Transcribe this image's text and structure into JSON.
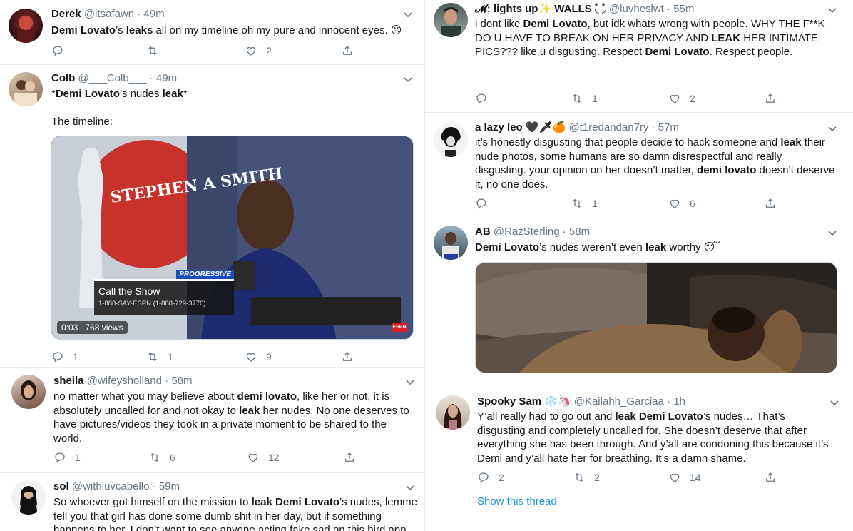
{
  "left": [
    {
      "name": "Derek",
      "handle": "@itsafawn",
      "time": "49m",
      "text": [
        [
          "n",
          "Demi Lovato"
        ],
        [
          "t",
          "’s "
        ],
        [
          "b",
          "leaks"
        ],
        [
          "t",
          " all on my timeline oh my pure and innocent eyes. 😣"
        ]
      ],
      "reply": "",
      "retweet": "",
      "like": "2"
    },
    {
      "name": "Colb",
      "handle": "@___Colb___",
      "time": "49m",
      "text": [
        [
          "t",
          "*"
        ],
        [
          "b",
          "Demi Lovato"
        ],
        [
          "t",
          "’s nudes "
        ],
        [
          "b",
          "leak"
        ],
        [
          "t",
          "*"
        ]
      ],
      "text2": "The timeline:",
      "video": {
        "time": "0:03",
        "views": "768 views",
        "lower_title": "Call the Show",
        "lower_sub": "1-888-SAY-ESPN (1-888-729-3776)",
        "brand": "STEPHEN A SMITH",
        "tag": "PROGRESSIVE"
      },
      "reply": "1",
      "retweet": "1",
      "like": "9"
    },
    {
      "name": "sheila",
      "handle": "@wifeysholland",
      "time": "58m",
      "text": [
        [
          "t",
          "no matter what you may believe about "
        ],
        [
          "b",
          "demi lovato"
        ],
        [
          "t",
          ", like her or not, it is absolutely uncalled for and not okay to "
        ],
        [
          "b",
          "leak"
        ],
        [
          "t",
          " her nudes. No one deserves to have pictures/videos they took in a private moment to be shared to the world."
        ]
      ],
      "reply": "1",
      "retweet": "6",
      "like": "12"
    },
    {
      "name": "sol",
      "handle": "@withluvcabello",
      "time": "59m",
      "text": [
        [
          "t",
          "So whoever got himself on the mission to "
        ],
        [
          "b",
          "leak Demi Lovato"
        ],
        [
          "t",
          "’s nudes, lemme tell you that girl has done some dumb shit in her day, but if something happens to her, I don’t want to see anyone acting fake sad on this bird app."
        ]
      ]
    }
  ],
  "right": [
    {
      "name": "𝓜; lights up✨ WALLS ◟̽ ◞̽",
      "handle": "@luvheslwt",
      "time": "55m",
      "text": [
        [
          "t",
          "i dont like "
        ],
        [
          "b",
          "Demi Lovato"
        ],
        [
          "t",
          ", but idk whats wrong with people. WHY THE F**K DO U HAVE TO BREAK ON HER PRIVACY AND "
        ],
        [
          "b",
          "LEAK"
        ],
        [
          "t",
          " HER INTIMATE PICS??? like u disgusting. Respect "
        ],
        [
          "b",
          "Demi Lovato"
        ],
        [
          "t",
          ". Respect people."
        ]
      ],
      "reply": "",
      "retweet": "1",
      "like": "2"
    },
    {
      "name": "a lazy leo 🖤🗡🍊",
      "handle": "@t1redandan7ry",
      "time": "57m",
      "text": [
        [
          "t",
          "it’s honestly disgusting that people decide to hack someone and "
        ],
        [
          "b",
          "leak"
        ],
        [
          "t",
          " their nude photos, some humans are so damn disrespectful and really disgusting. your opinion on her doesn’t matter, "
        ],
        [
          "b",
          "demi lovato"
        ],
        [
          "t",
          " doesn’t deserve it, no one does."
        ]
      ],
      "reply": "",
      "retweet": "1",
      "like": "6"
    },
    {
      "name": "AB",
      "handle": "@RazSterling",
      "time": "58m",
      "text": [
        [
          "b",
          "Demi Lovato"
        ],
        [
          "t",
          "’s nudes weren’t even "
        ],
        [
          "b",
          "leak"
        ],
        [
          "t",
          " worthy 😴"
        ]
      ]
    },
    {
      "name": "Spooky Sam ❄️🦄",
      "handle": "@Kailahh_Garciaa",
      "time": "1h",
      "text": [
        [
          "t",
          "Y’all really had to go out and "
        ],
        [
          "b",
          "leak Demi Lovato"
        ],
        [
          "t",
          "’s nudes… That’s disgusting and completely uncalled for. She doesn’t deserve that after everything she has been through. And y’all are condoning this because it’s Demi and y’all hate her for breathing. It’s a damn shame."
        ]
      ],
      "reply": "2",
      "retweet": "2",
      "like": "14",
      "show_thread": "Show this thread"
    }
  ],
  "colors": {
    "text": "#14171a",
    "muted": "#657786",
    "link": "#1b95e0",
    "border": "#e6ecf0"
  }
}
